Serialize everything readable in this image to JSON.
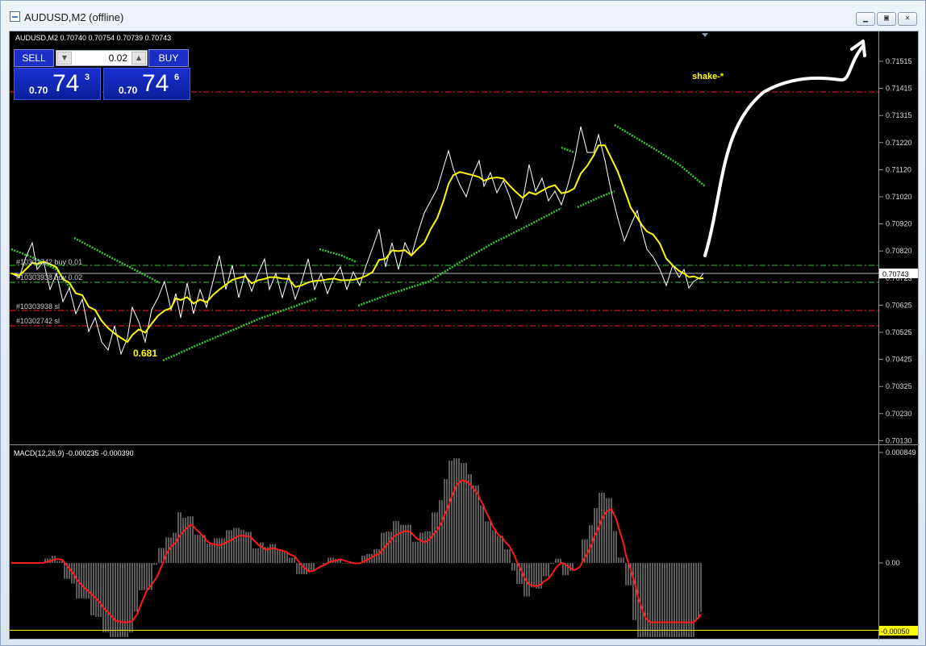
{
  "window": {
    "title": "AUDUSD,M2 (offline)",
    "minimize_icon": "minimize-icon",
    "restore_icon": "restore-icon",
    "close_icon": "close-icon"
  },
  "chart": {
    "header": "AUDUSD,M2  0.70740 0.70754 0.70739 0.70743",
    "current_price_label": "0.70743",
    "price_scale": [
      "0.71515",
      "0.71415",
      "0.71315",
      "0.71220",
      "0.71120",
      "0.71020",
      "0.70920",
      "0.70820",
      "0.70723",
      "0.70625",
      "0.70525",
      "0.70425",
      "0.70325",
      "0.70230",
      "0.70130"
    ],
    "order_labels": [
      "#10302742 buy 0.01",
      "#10303938 buy 0.02",
      "#10303938 sl",
      "#10302742 sl"
    ],
    "annotations": {
      "low_label": "0.681",
      "shake_label": "shake-*"
    },
    "colors": {
      "background": "#000000",
      "price": "#ffffff",
      "ma": "#ffff00",
      "trend": "#32cd32",
      "macd_signal": "#ff1a1a",
      "sl_line": "#ff2020",
      "buy_line": "#32c832",
      "arrow": "#ffffff"
    }
  },
  "macd": {
    "header": "MACD(12,26,9) -0.000235 -0.000390",
    "scale": [
      "0.000849",
      "0.00",
      "-0.00050"
    ]
  },
  "trade_panel": {
    "sell_label": "SELL",
    "buy_label": "BUY",
    "lot_value": "0.02",
    "bid": {
      "small": "0.70",
      "big": "74",
      "sup": "3"
    },
    "ask": {
      "small": "0.70",
      "big": "74",
      "sup": "6"
    }
  }
}
